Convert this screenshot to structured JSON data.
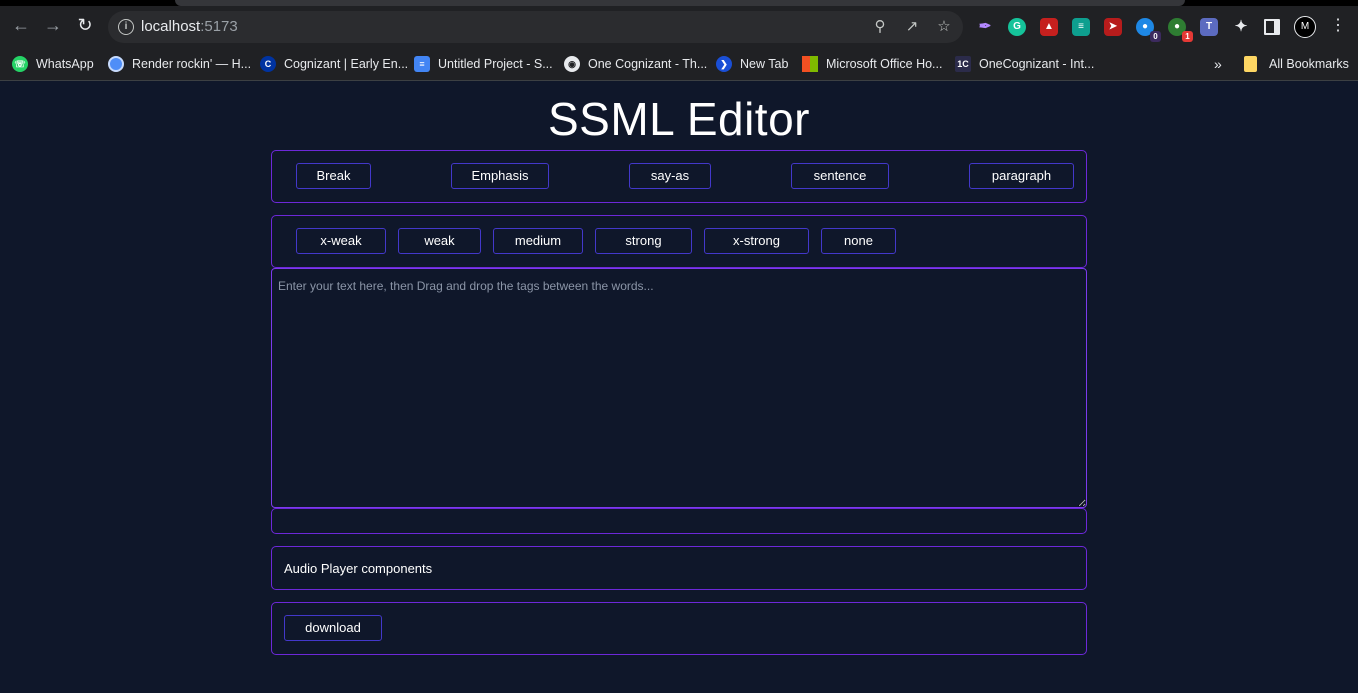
{
  "browser": {
    "url_host": "localhost",
    "url_port": ":5173",
    "profile_initial": "M",
    "extension_badges": {
      "ghost": "0",
      "ideas": "1"
    },
    "bookmarks": [
      {
        "label": "WhatsApp",
        "icon": "whatsapp-icon",
        "color": "#25d366"
      },
      {
        "label": "Render rockin' — H...",
        "icon": "render-icon",
        "color": "#4f8ef7"
      },
      {
        "label": "Cognizant | Early En...",
        "icon": "cognizant-icon",
        "color": "#0033a1"
      },
      {
        "label": "Untitled Project - S...",
        "icon": "document-icon",
        "color": "#4285f4"
      },
      {
        "label": "One Cognizant - Th...",
        "icon": "globe-icon",
        "color": "#e8eaed"
      },
      {
        "label": "New Tab",
        "icon": "new-tab-icon",
        "color": "#1a4fd6"
      },
      {
        "label": "Microsoft Office Ho...",
        "icon": "microsoft-icon",
        "color": "#f25022"
      },
      {
        "label": "OneCognizant - Int...",
        "icon": "onecognizant-icon",
        "color": "#2b2b4a"
      }
    ],
    "all_bookmarks_label": "All Bookmarks"
  },
  "page": {
    "title": "SSML Editor",
    "tags": [
      "Break",
      "Emphasis",
      "say-as",
      "sentence",
      "paragraph"
    ],
    "strengths": [
      "x-weak",
      "weak",
      "medium",
      "strong",
      "x-strong",
      "none"
    ],
    "editor": {
      "value": "",
      "placeholder": "Enter your text here, then Drag and drop the tags between the words..."
    },
    "audio_label": "Audio Player components",
    "download_label": "download"
  },
  "colors": {
    "background": "#0f172a",
    "panel_border": "#6d28d9",
    "button_border": "#4338ca"
  }
}
